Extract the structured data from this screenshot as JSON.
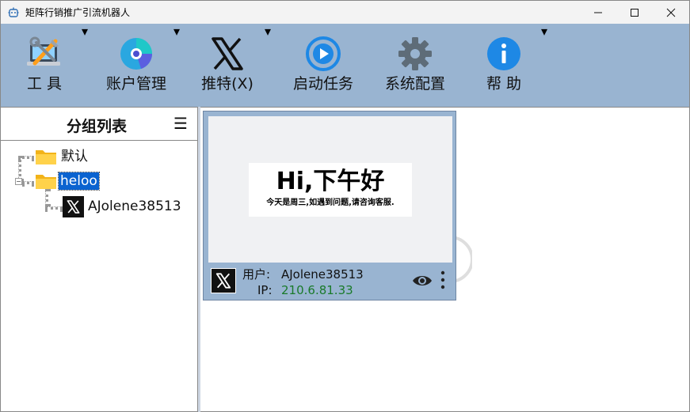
{
  "window": {
    "title": "矩阵行销推广引流机器人"
  },
  "toolbar": {
    "items": [
      {
        "label": "工  具",
        "icon": "tools-laptop-icon",
        "has_dropdown": true
      },
      {
        "label": "账户管理",
        "icon": "account-pie-icon",
        "has_dropdown": true
      },
      {
        "label": "推特(X)",
        "icon": "x-logo-icon",
        "has_dropdown": true
      },
      {
        "label": "启动任务",
        "icon": "play-circle-icon",
        "has_dropdown": false
      },
      {
        "label": "系统配置",
        "icon": "gear-icon",
        "has_dropdown": false
      },
      {
        "label": "帮  助",
        "icon": "info-icon",
        "has_dropdown": true
      }
    ]
  },
  "left_panel": {
    "title": "分组列表",
    "menu_glyph": "☰",
    "tree": {
      "groups": [
        {
          "name": "默认"
        },
        {
          "name": "heloo",
          "selected": true,
          "children": [
            {
              "name": "AJolene38513"
            }
          ]
        }
      ]
    }
  },
  "card": {
    "greeting": "Hi,下午好",
    "message": "今天是周三,如遇到问题,请咨询客服.",
    "user_label": "用户:",
    "user_value": "AJolene38513",
    "ip_label": "IP:",
    "ip_value": "210.6.81.33"
  },
  "colors": {
    "toolbar_bg": "#99b4d1",
    "selection": "#0b63d0",
    "ip_green": "#1a7a2a",
    "play_blue": "#1e88e5",
    "info_blue": "#1e88e5",
    "gear_gray": "#5e6c78"
  }
}
